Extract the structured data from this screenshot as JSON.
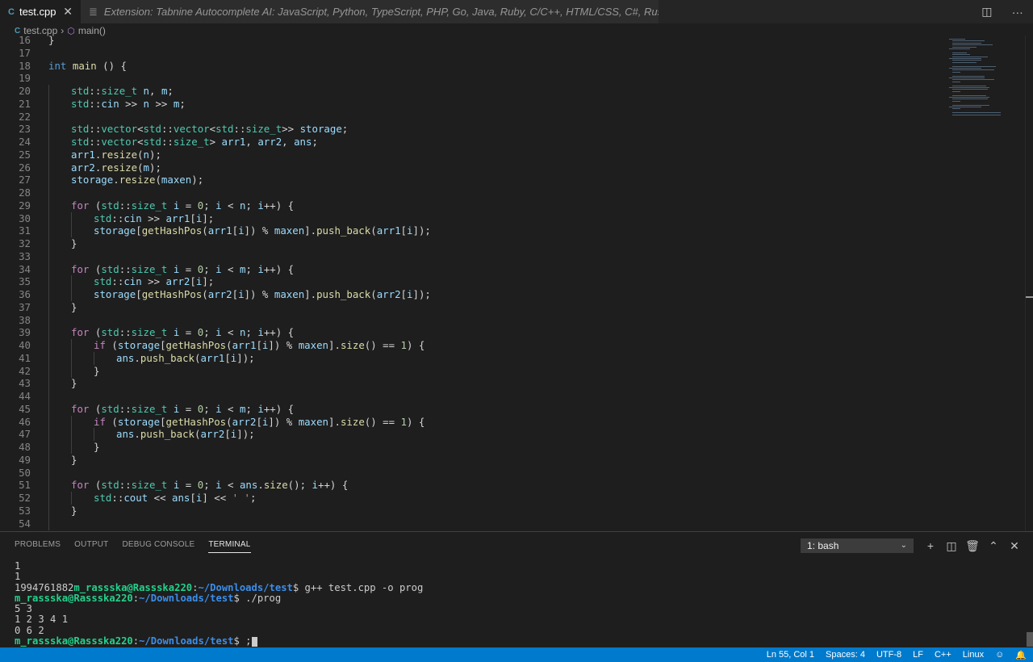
{
  "tabs": {
    "active": {
      "icon": "C",
      "label": "test.cpp",
      "close": "✕"
    },
    "inactive": {
      "label": "Extension: Tabnine Autocomplete AI: JavaScript, Python, TypeScript, PHP, Go, Java, Ruby, C/C++, HTML/CSS, C#, Rust, SQL, Bash, Kotlin, React"
    }
  },
  "breadcrumb": {
    "file": "test.cpp",
    "symbol": "main()"
  },
  "code_lines": [
    {
      "n": "16",
      "i": 0,
      "h": "}"
    },
    {
      "n": "17",
      "i": 0,
      "h": ""
    },
    {
      "n": "18",
      "i": 0,
      "h": "<span class='k'>int</span> <span class='f'>main</span> () {"
    },
    {
      "n": "19",
      "i": 0,
      "h": ""
    },
    {
      "n": "20",
      "i": 1,
      "h": "<span class='t'>std</span>::<span class='t'>size_t</span> <span class='v'>n</span>, <span class='v'>m</span>;"
    },
    {
      "n": "21",
      "i": 1,
      "h": "<span class='t'>std</span>::<span class='v'>cin</span> &gt;&gt; <span class='v'>n</span> &gt;&gt; <span class='v'>m</span>;"
    },
    {
      "n": "22",
      "i": 1,
      "h": ""
    },
    {
      "n": "23",
      "i": 1,
      "h": "<span class='t'>std</span>::<span class='t'>vector</span>&lt;<span class='t'>std</span>::<span class='t'>vector</span>&lt;<span class='t'>std</span>::<span class='t'>size_t</span>&gt;&gt; <span class='v'>storage</span>;"
    },
    {
      "n": "24",
      "i": 1,
      "h": "<span class='t'>std</span>::<span class='t'>vector</span>&lt;<span class='t'>std</span>::<span class='t'>size_t</span>&gt; <span class='v'>arr1</span>, <span class='v'>arr2</span>, <span class='v'>ans</span>;"
    },
    {
      "n": "25",
      "i": 1,
      "h": "<span class='v'>arr1</span>.<span class='f'>resize</span>(<span class='v'>n</span>);"
    },
    {
      "n": "26",
      "i": 1,
      "h": "<span class='v'>arr2</span>.<span class='f'>resize</span>(<span class='v'>m</span>);"
    },
    {
      "n": "27",
      "i": 1,
      "h": "<span class='v'>storage</span>.<span class='f'>resize</span>(<span class='v'>maxen</span>);"
    },
    {
      "n": "28",
      "i": 1,
      "h": ""
    },
    {
      "n": "29",
      "i": 1,
      "h": "<span class='c'>for</span> (<span class='t'>std</span>::<span class='t'>size_t</span> <span class='v'>i</span> = <span class='n'>0</span>; <span class='v'>i</span> &lt; <span class='v'>n</span>; <span class='v'>i</span>++) {"
    },
    {
      "n": "30",
      "i": 2,
      "h": "<span class='t'>std</span>::<span class='v'>cin</span> &gt;&gt; <span class='v'>arr1</span>[<span class='v'>i</span>];"
    },
    {
      "n": "31",
      "i": 2,
      "h": "<span class='v'>storage</span>[<span class='f'>getHashPos</span>(<span class='v'>arr1</span>[<span class='v'>i</span>]) % <span class='v'>maxen</span>].<span class='f'>push_back</span>(<span class='v'>arr1</span>[<span class='v'>i</span>]);"
    },
    {
      "n": "32",
      "i": 1,
      "h": "}"
    },
    {
      "n": "33",
      "i": 1,
      "h": ""
    },
    {
      "n": "34",
      "i": 1,
      "h": "<span class='c'>for</span> (<span class='t'>std</span>::<span class='t'>size_t</span> <span class='v'>i</span> = <span class='n'>0</span>; <span class='v'>i</span> &lt; <span class='v'>m</span>; <span class='v'>i</span>++) {"
    },
    {
      "n": "35",
      "i": 2,
      "h": "<span class='t'>std</span>::<span class='v'>cin</span> &gt;&gt; <span class='v'>arr2</span>[<span class='v'>i</span>];"
    },
    {
      "n": "36",
      "i": 2,
      "h": "<span class='v'>storage</span>[<span class='f'>getHashPos</span>(<span class='v'>arr2</span>[<span class='v'>i</span>]) % <span class='v'>maxen</span>].<span class='f'>push_back</span>(<span class='v'>arr2</span>[<span class='v'>i</span>]);"
    },
    {
      "n": "37",
      "i": 1,
      "h": "}"
    },
    {
      "n": "38",
      "i": 1,
      "h": ""
    },
    {
      "n": "39",
      "i": 1,
      "h": "<span class='c'>for</span> (<span class='t'>std</span>::<span class='t'>size_t</span> <span class='v'>i</span> = <span class='n'>0</span>; <span class='v'>i</span> &lt; <span class='v'>n</span>; <span class='v'>i</span>++) {"
    },
    {
      "n": "40",
      "i": 2,
      "h": "<span class='c'>if</span> (<span class='v'>storage</span>[<span class='f'>getHashPos</span>(<span class='v'>arr1</span>[<span class='v'>i</span>]) % <span class='v'>maxen</span>].<span class='f'>size</span>() == <span class='n'>1</span>) {"
    },
    {
      "n": "41",
      "i": 3,
      "h": "<span class='v'>ans</span>.<span class='f'>push_back</span>(<span class='v'>arr1</span>[<span class='v'>i</span>]);"
    },
    {
      "n": "42",
      "i": 2,
      "h": "}"
    },
    {
      "n": "43",
      "i": 1,
      "h": "}"
    },
    {
      "n": "44",
      "i": 1,
      "h": ""
    },
    {
      "n": "45",
      "i": 1,
      "h": "<span class='c'>for</span> (<span class='t'>std</span>::<span class='t'>size_t</span> <span class='v'>i</span> = <span class='n'>0</span>; <span class='v'>i</span> &lt; <span class='v'>m</span>; <span class='v'>i</span>++) {"
    },
    {
      "n": "46",
      "i": 2,
      "h": "<span class='c'>if</span> (<span class='v'>storage</span>[<span class='f'>getHashPos</span>(<span class='v'>arr2</span>[<span class='v'>i</span>]) % <span class='v'>maxen</span>].<span class='f'>size</span>() == <span class='n'>1</span>) {"
    },
    {
      "n": "47",
      "i": 3,
      "h": "<span class='v'>ans</span>.<span class='f'>push_back</span>(<span class='v'>arr2</span>[<span class='v'>i</span>]);"
    },
    {
      "n": "48",
      "i": 2,
      "h": "}"
    },
    {
      "n": "49",
      "i": 1,
      "h": "}"
    },
    {
      "n": "50",
      "i": 1,
      "h": ""
    },
    {
      "n": "51",
      "i": 1,
      "h": "<span class='c'>for</span> (<span class='t'>std</span>::<span class='t'>size_t</span> <span class='v'>i</span> = <span class='n'>0</span>; <span class='v'>i</span> &lt; <span class='v'>ans</span>.<span class='f'>size</span>(); <span class='v'>i</span>++) {"
    },
    {
      "n": "52",
      "i": 2,
      "h": "<span class='t'>std</span>::<span class='v'>cout</span> &lt;&lt; <span class='v'>ans</span>[<span class='v'>i</span>] &lt;&lt; <span class='s'>' '</span>;"
    },
    {
      "n": "53",
      "i": 1,
      "h": "}"
    },
    {
      "n": "54",
      "i": 1,
      "h": ""
    }
  ],
  "panel": {
    "tabs": [
      "PROBLEMS",
      "OUTPUT",
      "DEBUG CONSOLE",
      "TERMINAL"
    ],
    "active_tab": "TERMINAL",
    "shell_select": "1: bash",
    "actions": [
      "plus-icon",
      "split-icon",
      "trash-icon",
      "chevron-up-icon",
      "close-icon"
    ]
  },
  "terminal": {
    "prompt_user": "m_rassska@Rassska220",
    "prompt_path": "~/Downloads/test",
    "lines": [
      {
        "text": "1"
      },
      {
        "text": "1"
      },
      {
        "pre": "1994761882",
        "cmd": "$ g++ test.cpp -o prog"
      },
      {
        "pre": "",
        "cmd": "$ ./prog"
      },
      {
        "text": "5 3"
      },
      {
        "text": "1 2 3 4 1"
      },
      {
        "text": "0 6 2"
      },
      {
        "pre": "",
        "cmd": "$ ;",
        "cursor": true
      }
    ]
  },
  "status": {
    "position": "Ln 55, Col 1",
    "spaces": "Spaces: 4",
    "encoding": "UTF-8",
    "eol": "LF",
    "language": "C++",
    "os": "Linux"
  },
  "colors": {
    "statusbar": "#007acc",
    "prompt_user": "#23d18b",
    "prompt_path": "#3b8eea"
  }
}
